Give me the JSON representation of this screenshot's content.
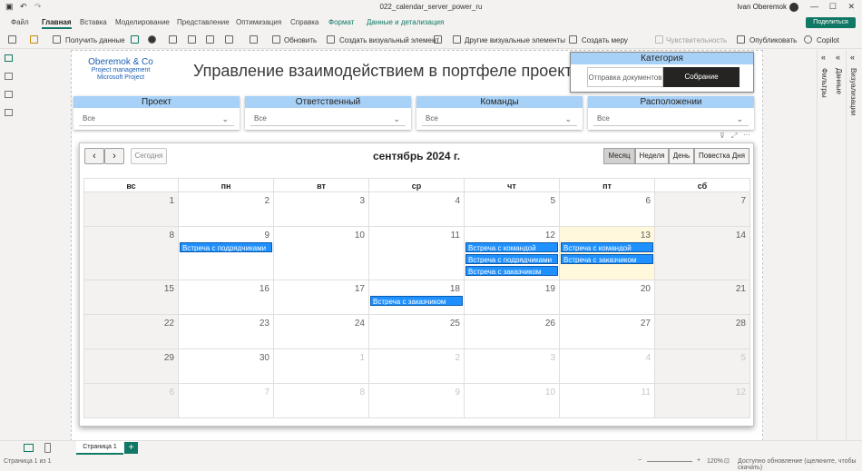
{
  "window": {
    "title": "022_calendar_server_power_ru",
    "user": "Ivan Oberemok"
  },
  "menu": [
    "Файл",
    "Главная",
    "Вставка",
    "Моделирование",
    "Представление",
    "Оптимизация",
    "Справка",
    "Формат",
    "Данные и детализация"
  ],
  "share_label": "Поделиться",
  "toolbar": {
    "get_data": "Получить данные",
    "refresh": "Обновить",
    "create_visual": "Создать визуальный элемент",
    "other_visuals": "Другие визуальные элементы",
    "create_measure": "Создать меру",
    "sensitivity": "Чувствительность",
    "publish": "Опубликовать",
    "copilot": "Copilot"
  },
  "panes": {
    "filters": "Фильтры",
    "visualizations": "Визуализации",
    "data": "Данные"
  },
  "brand": {
    "name": "Oberemok & Co",
    "line1": "Project management",
    "line2": "Microsoft Project"
  },
  "page_title": "Управление взаимодействием в портфеле проектов",
  "category": {
    "header": "Категория",
    "options": [
      "Отправка документов",
      "Собрание"
    ],
    "selected": "Собрание"
  },
  "filters": [
    {
      "label": "Проект",
      "value": "Все"
    },
    {
      "label": "Ответственный",
      "value": "Все"
    },
    {
      "label": "Команды",
      "value": "Все"
    },
    {
      "label": "Расположении",
      "value": "Все"
    }
  ],
  "calendar": {
    "today_label": "Сегодня",
    "title": "сентябрь 2024 г.",
    "views": [
      "Месяц",
      "Неделя",
      "День",
      "Повестка Дня"
    ],
    "active_view": "Месяц",
    "weekdays": [
      "вс",
      "пн",
      "вт",
      "ср",
      "чт",
      "пт",
      "сб"
    ],
    "weeks": [
      [
        {
          "d": "1"
        },
        {
          "d": "2"
        },
        {
          "d": "3"
        },
        {
          "d": "4"
        },
        {
          "d": "5"
        },
        {
          "d": "6"
        },
        {
          "d": "7"
        }
      ],
      [
        {
          "d": "8"
        },
        {
          "d": "9",
          "events": [
            "Встреча с подрядчиками"
          ]
        },
        {
          "d": "10"
        },
        {
          "d": "11"
        },
        {
          "d": "12",
          "events": [
            "Встреча с командой",
            "Встреча с подрядчиками",
            "Встреча с заказчиком"
          ]
        },
        {
          "d": "13",
          "today": true,
          "events": [
            "Встреча с командой",
            "Встреча с заказчиком"
          ]
        },
        {
          "d": "14"
        }
      ],
      [
        {
          "d": "15"
        },
        {
          "d": "16"
        },
        {
          "d": "17"
        },
        {
          "d": "18",
          "events": [
            "Встреча с заказчиком"
          ]
        },
        {
          "d": "19"
        },
        {
          "d": "20"
        },
        {
          "d": "21"
        }
      ],
      [
        {
          "d": "22"
        },
        {
          "d": "23"
        },
        {
          "d": "24"
        },
        {
          "d": "25"
        },
        {
          "d": "26"
        },
        {
          "d": "27"
        },
        {
          "d": "28"
        }
      ],
      [
        {
          "d": "29"
        },
        {
          "d": "30"
        },
        {
          "d": "1",
          "other": true
        },
        {
          "d": "2",
          "other": true
        },
        {
          "d": "3",
          "other": true
        },
        {
          "d": "4",
          "other": true
        },
        {
          "d": "5",
          "other": true
        }
      ],
      [
        {
          "d": "6",
          "other": true
        },
        {
          "d": "7",
          "other": true
        },
        {
          "d": "8",
          "other": true
        },
        {
          "d": "9",
          "other": true
        },
        {
          "d": "10",
          "other": true
        },
        {
          "d": "11",
          "other": true
        },
        {
          "d": "12",
          "other": true
        }
      ]
    ]
  },
  "page_tab": "Страница 1",
  "status": {
    "page": "Страница 1 из 1",
    "zoom": "120%",
    "update": "Доступно обновление (щелкните, чтобы скачать)"
  }
}
